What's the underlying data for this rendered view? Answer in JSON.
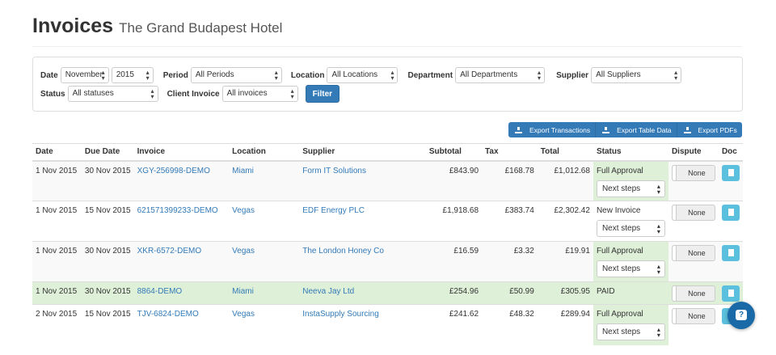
{
  "header": {
    "title": "Invoices",
    "subtitle": "The Grand Budapest Hotel"
  },
  "filters": {
    "date_label": "Date",
    "month": "November",
    "year": "2015",
    "period_label": "Period",
    "period": "All Periods",
    "location_label": "Location",
    "location": "All Locations",
    "department_label": "Department",
    "department": "All Departments",
    "supplier_label": "Supplier",
    "supplier": "All Suppliers",
    "status_label": "Status",
    "status": "All statuses",
    "client_invoice_label": "Client Invoice",
    "client_invoice": "All invoices",
    "filter_button": "Filter"
  },
  "exports": {
    "transactions": "Export Transactions",
    "table_data": "Export Table Data",
    "pdfs": "Export PDFs"
  },
  "table": {
    "columns": [
      "Date",
      "Due Date",
      "Invoice",
      "Location",
      "Supplier",
      "Subtotal",
      "Tax",
      "Total",
      "Status",
      "Dispute",
      "Doc"
    ],
    "next_steps": "Next steps",
    "dispute": "None",
    "rows": [
      {
        "date": "1 Nov 2015",
        "due": "30 Nov 2015",
        "invoice": "XGY-256998-DEMO",
        "location": "Miami",
        "supplier": "Form IT Solutions",
        "subtotal": "£843.90",
        "tax": "£168.78",
        "total": "£1,012.68",
        "status": "Full Approval"
      },
      {
        "date": "1 Nov 2015",
        "due": "15 Nov 2015",
        "invoice": "621571399233-DEMO",
        "location": "Vegas",
        "supplier": "EDF Energy PLC",
        "subtotal": "£1,918.68",
        "tax": "£383.74",
        "total": "£2,302.42",
        "status": "New Invoice"
      },
      {
        "date": "1 Nov 2015",
        "due": "30 Nov 2015",
        "invoice": "XKR-6572-DEMO",
        "location": "Vegas",
        "supplier": "The London Honey Co",
        "subtotal": "£16.59",
        "tax": "£3.32",
        "total": "£19.91",
        "status": "Full Approval"
      },
      {
        "date": "1 Nov 2015",
        "due": "30 Nov 2015",
        "invoice": "8864-DEMO",
        "location": "Miami",
        "supplier": "Neeva Jay Ltd",
        "subtotal": "£254.96",
        "tax": "£50.99",
        "total": "£305.95",
        "status": "PAID"
      },
      {
        "date": "2 Nov 2015",
        "due": "15 Nov 2015",
        "invoice": "TJV-6824-DEMO",
        "location": "Vegas",
        "supplier": "InstaSupply Sourcing",
        "subtotal": "£241.62",
        "tax": "£48.32",
        "total": "£289.94",
        "status": "Full Approval"
      }
    ]
  },
  "colors": {
    "primary": "#337ab7",
    "info": "#5bc0de",
    "success_bg": "#dff0d8",
    "fab": "#1a6aa8"
  },
  "icons": {
    "export": "download-icon",
    "doc": "file-icon",
    "help": "chat-help-icon"
  }
}
